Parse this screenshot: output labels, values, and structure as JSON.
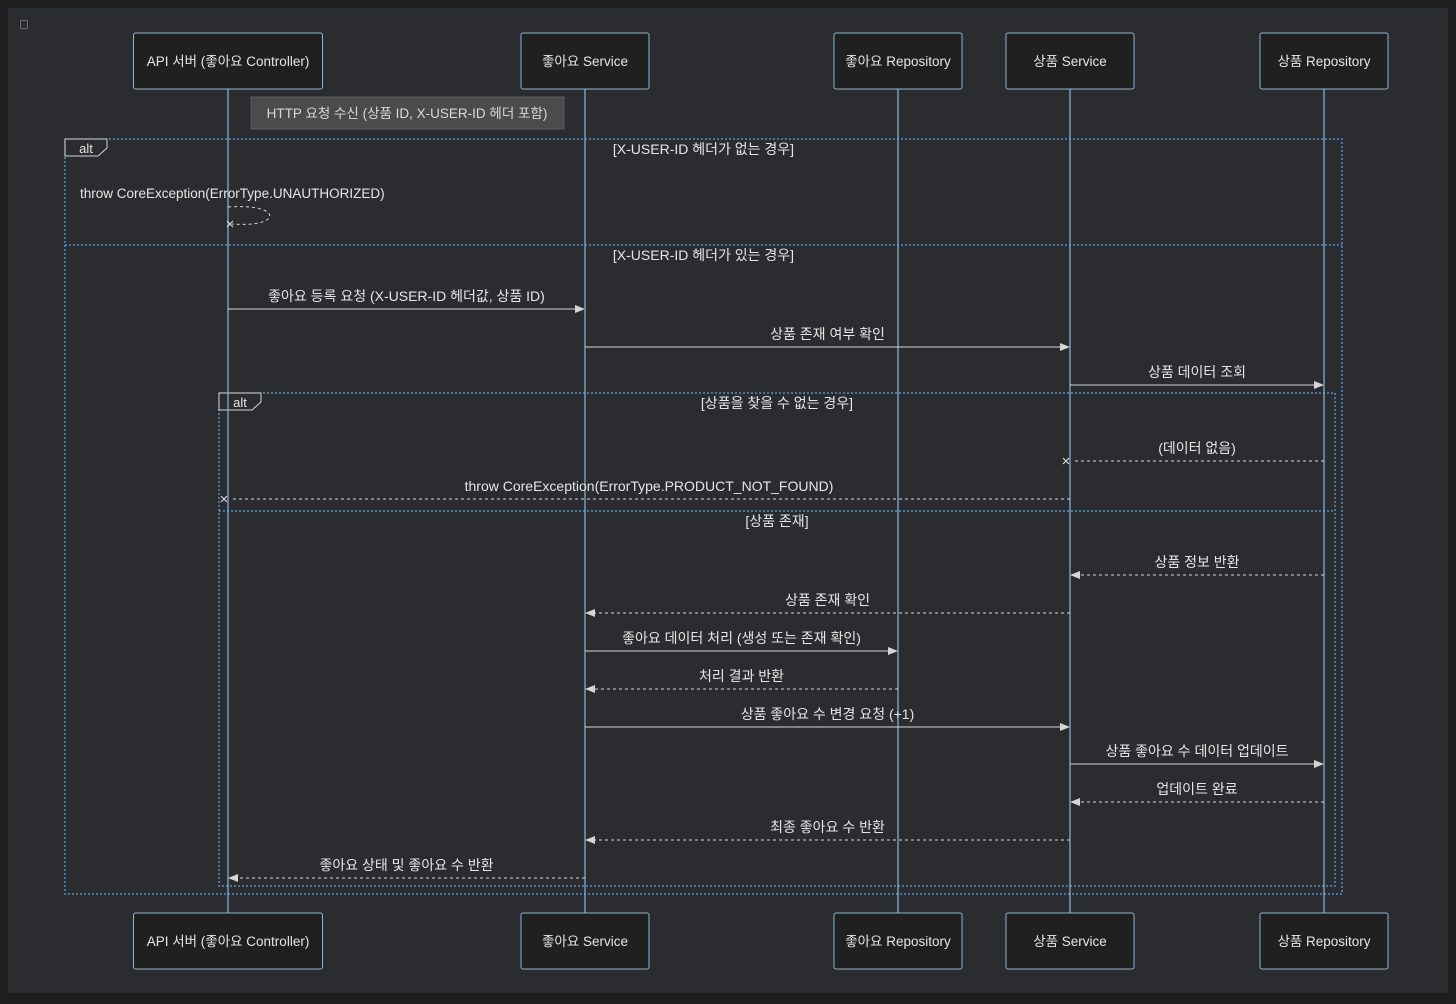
{
  "participants": [
    {
      "id": "api",
      "label": "API 서버 (좋아요 Controller)"
    },
    {
      "id": "likeService",
      "label": "좋아요 Service"
    },
    {
      "id": "likeRepo",
      "label": "좋아요 Repository"
    },
    {
      "id": "productService",
      "label": "상품 Service"
    },
    {
      "id": "productRepo",
      "label": "상품 Repository"
    }
  ],
  "note": "HTTP 요청 수신 (상품 ID, X-USER-ID 헤더 포함)",
  "outer_alt": {
    "keyword": "alt",
    "condition_1": "[X-USER-ID 헤더가 없는 경우]",
    "condition_2": "[X-USER-ID 헤더가 있는 경우]"
  },
  "inner_alt": {
    "keyword": "alt",
    "condition_1": "[상품을 찾을 수 없는 경우]",
    "condition_2": "[상품 존재]"
  },
  "messages": [
    {
      "from": "api",
      "to": "api",
      "text": "throw CoreException(ErrorType.UNAUTHORIZED)",
      "style": "self-dashed-cross"
    },
    {
      "from": "api",
      "to": "likeService",
      "text": "좋아요 등록 요청 (X-USER-ID 헤더값, 상품 ID)",
      "style": "solid"
    },
    {
      "from": "likeService",
      "to": "productService",
      "text": "상품 존재 여부 확인",
      "style": "solid"
    },
    {
      "from": "productService",
      "to": "productRepo",
      "text": "상품 데이터 조회",
      "style": "solid"
    },
    {
      "from": "productRepo",
      "to": "productService",
      "text": "(데이터 없음)",
      "style": "dashed-cross"
    },
    {
      "from": "productService",
      "to": "api",
      "text": "throw CoreException(ErrorType.PRODUCT_NOT_FOUND)",
      "style": "dashed-cross"
    },
    {
      "from": "productRepo",
      "to": "productService",
      "text": "상품 정보 반환",
      "style": "dashed"
    },
    {
      "from": "productService",
      "to": "likeService",
      "text": "상품 존재 확인",
      "style": "dashed"
    },
    {
      "from": "likeService",
      "to": "likeRepo",
      "text": "좋아요 데이터 처리 (생성 또는 존재 확인)",
      "style": "solid"
    },
    {
      "from": "likeRepo",
      "to": "likeService",
      "text": "처리 결과 반환",
      "style": "dashed"
    },
    {
      "from": "likeService",
      "to": "productService",
      "text": "상품 좋아요 수 변경 요청 (+1)",
      "style": "solid"
    },
    {
      "from": "productService",
      "to": "productRepo",
      "text": "상품 좋아요 수 데이터 업데이트",
      "style": "solid"
    },
    {
      "from": "productRepo",
      "to": "productService",
      "text": "업데이트 완료",
      "style": "dashed"
    },
    {
      "from": "productService",
      "to": "likeService",
      "text": "최종 좋아요 수 반환",
      "style": "dashed"
    },
    {
      "from": "likeService",
      "to": "api",
      "text": "좋아요 상태 및 좋아요 수 반환",
      "style": "dashed"
    }
  ],
  "colors": {
    "background": "#2b2c2f",
    "actor_fill": "#1f2020",
    "actor_stroke": "#8ab4d8",
    "lifeline": "#8ab4d8",
    "arrow": "#d6d6d6",
    "text": "#e6e6e6",
    "note_fill": "#4a4b4d",
    "note_text": "#d9d9d9",
    "frame": "#5aa2e6"
  }
}
